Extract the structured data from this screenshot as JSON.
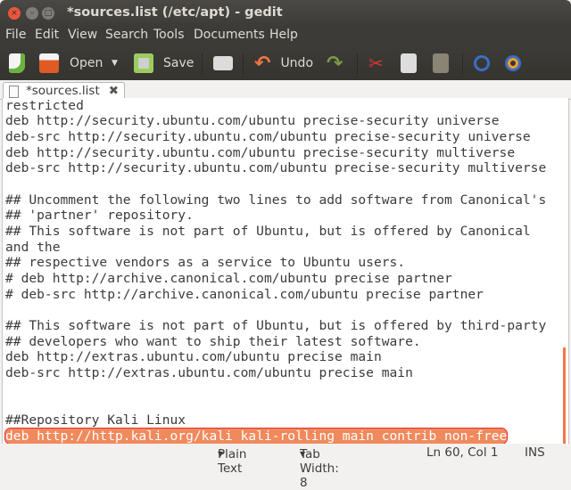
{
  "window": {
    "title": "*sources.list (/etc/apt) - gedit"
  },
  "menu": [
    "File",
    "Edit",
    "View",
    "Search",
    "Tools",
    "Documents",
    "Help"
  ],
  "toolbar": {
    "open_label": "Open",
    "save_label": "Save",
    "undo_label": "Undo"
  },
  "tab": {
    "label": "*sources.list"
  },
  "editor": {
    "lines": [
      "restricted",
      "deb http://security.ubuntu.com/ubuntu precise-security universe",
      "deb-src http://security.ubuntu.com/ubuntu precise-security universe",
      "deb http://security.ubuntu.com/ubuntu precise-security multiverse",
      "deb-src http://security.ubuntu.com/ubuntu precise-security multiverse",
      "",
      "## Uncomment the following two lines to add software from Canonical's",
      "## 'partner' repository.",
      "## This software is not part of Ubuntu, but is offered by Canonical",
      "and the",
      "## respective vendors as a service to Ubuntu users.",
      "# deb http://archive.canonical.com/ubuntu precise partner",
      "# deb-src http://archive.canonical.com/ubuntu precise partner",
      "",
      "## This software is not part of Ubuntu, but is offered by third-party",
      "## developers who want to ship their latest software.",
      "deb http://extras.ubuntu.com/ubuntu precise main",
      "deb-src http://extras.ubuntu.com/ubuntu precise main",
      "",
      "",
      "##Repository Kali Linux",
      "deb http://http.kali.org/kali kali-rolling main contrib non-free"
    ],
    "highlighted_line": 21,
    "highlight_color": "#f08a5d"
  },
  "status": {
    "language": "Plain Text",
    "tab_width": "Tab Width: 8",
    "position": "Ln 60, Col 1",
    "mode": "INS"
  }
}
